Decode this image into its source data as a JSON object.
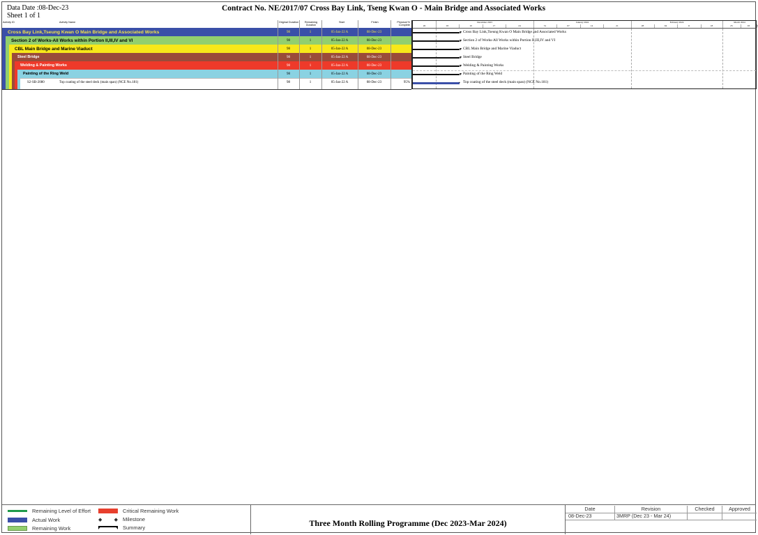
{
  "header": {
    "data_date": "Data Date :08-Dec-23",
    "sheet": "Sheet 1 of 1",
    "title": "Contract  No. NE/2017/07  Cross Bay Link, Tseng Kwan O - Main Bridge and Associated Works"
  },
  "table": {
    "columns": [
      "Activity ID",
      "Activity Name",
      "Original Duration",
      "Remaining Duration",
      "Start",
      "Finish",
      "Physical % Complete"
    ],
    "rows": [
      {
        "id": "",
        "name": "Cross Bay Link,Tseung Kwan O Main Bridge and Associated Works",
        "od": "98",
        "rd": "1",
        "start": "05-Jan-22 A",
        "finish": "08-Dec-23",
        "pct": "",
        "color": "#3a4fa8",
        "text_color": "#f3e24a"
      },
      {
        "id": "",
        "name": "Section 2 of Works-All Works within Portion II,III,IV and VI",
        "od": "98",
        "rd": "1",
        "start": "05-Jan-22 A",
        "finish": "08-Dec-23",
        "pct": "",
        "color": "#92cf6e",
        "text_color": "#000000"
      },
      {
        "id": "",
        "name": "CBL Main Bridge and Marine Viaduct",
        "od": "98",
        "rd": "1",
        "start": "05-Jan-22 A",
        "finish": "08-Dec-23",
        "pct": "",
        "color": "#f7e81a",
        "text_color": "#000000"
      },
      {
        "id": "",
        "name": "Steel Bridge",
        "od": "98",
        "rd": "1",
        "start": "05-Jan-22 A",
        "finish": "08-Dec-23",
        "pct": "",
        "color": "#9a4b3a",
        "text_color": "#ffffff"
      },
      {
        "id": "",
        "name": "Welding & Painting Works",
        "od": "98",
        "rd": "1",
        "start": "05-Jan-22 A",
        "finish": "08-Dec-23",
        "pct": "",
        "color": "#ee3a2a",
        "text_color": "#ffffff"
      },
      {
        "id": "",
        "name": "Painting of the Ring Weld",
        "od": "98",
        "rd": "1",
        "start": "05-Jan-22 A",
        "finish": "08-Dec-23",
        "pct": "",
        "color": "#8ad2e2",
        "text_color": "#000000"
      },
      {
        "id": "S2-SB-2080",
        "name": "Top coating of the steel deck (main span) (NCE No.181)",
        "od": "98",
        "rd": "1",
        "start": "05-Jan-22 A",
        "finish": "08-Dec-23",
        "pct": "95%",
        "color": "#ffffff",
        "text_color": "#000000"
      }
    ]
  },
  "gantt": {
    "months": [
      "",
      "December 2023",
      "January 2024",
      "February 2024",
      "March 2024"
    ],
    "weeks": [
      "26",
      "03",
      "10",
      "17",
      "24",
      "31",
      "07",
      "14",
      "21",
      "28",
      "04",
      "11",
      "18",
      "25",
      "03",
      "10"
    ],
    "labels": [
      "Cross Bay Link,Tseung Kwan O Main Bridge and Associated Works",
      "Section 2 of Works-All Works within Portion II,III,IV and VI",
      "CBL Main Bridge and Marine Viaduct",
      "Steel Bridge",
      "Welding & Painting Works",
      "Painting of the Ring Weld",
      "Top coating of the steel deck (main span) (NCE No.181)"
    ]
  },
  "legend": {
    "items": [
      {
        "label": "Remaining Level of Effort",
        "color": "#1e9a4a"
      },
      {
        "label": "Actual Work",
        "color": "#3a4fa8"
      },
      {
        "label": "Remaining Work",
        "color": "#92cf6e"
      },
      {
        "label": "Critical Remaining Work",
        "color": "#e8402e"
      },
      {
        "label": "Milestone",
        "color": "#000000"
      },
      {
        "label": "Summary",
        "color": "#000000"
      }
    ]
  },
  "footer": {
    "title": "Three Month Rolling Programme (Dec 2023-Mar 2024)",
    "rev_headers": [
      "Date",
      "Revision",
      "Checked",
      "Approved"
    ],
    "rev_rows": [
      [
        "08-Dec-23",
        "3MRP (Dec 23 - Mar 24)",
        "",
        ""
      ]
    ]
  }
}
